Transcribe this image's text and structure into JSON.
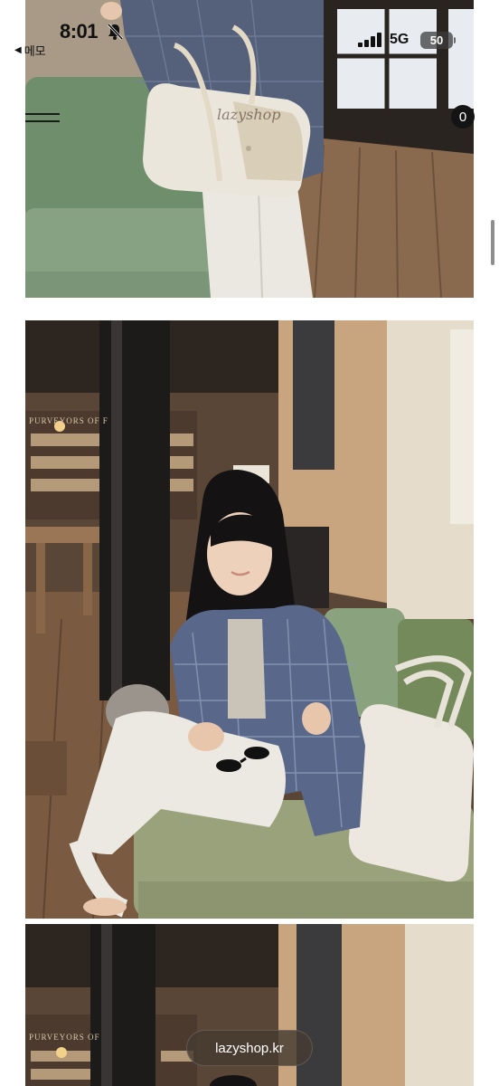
{
  "status_bar": {
    "back_label": "메모",
    "time": "8:01",
    "network": "5G",
    "battery": "50"
  },
  "overlay": {
    "cart_count": "0",
    "watermark": "lazyshop",
    "url": "lazyshop.kr"
  },
  "photos": {
    "photo_2_store_sign": "PURVEYORS OF F",
    "photo_3_store_sign": "PURVEYORS OF"
  },
  "icons": {
    "back": "back-triangle-icon",
    "bell": "bell-slash-icon",
    "signal": "signal-bars-icon",
    "menu": "hamburger-menu-icon"
  },
  "colors": {
    "sofa_green": "#7f9a7c",
    "wood_floor": "#8a6a4e",
    "jacket_blue": "#5b6b8c",
    "pants_white": "#ece9e2",
    "bag_cream": "#ebe6dc"
  }
}
